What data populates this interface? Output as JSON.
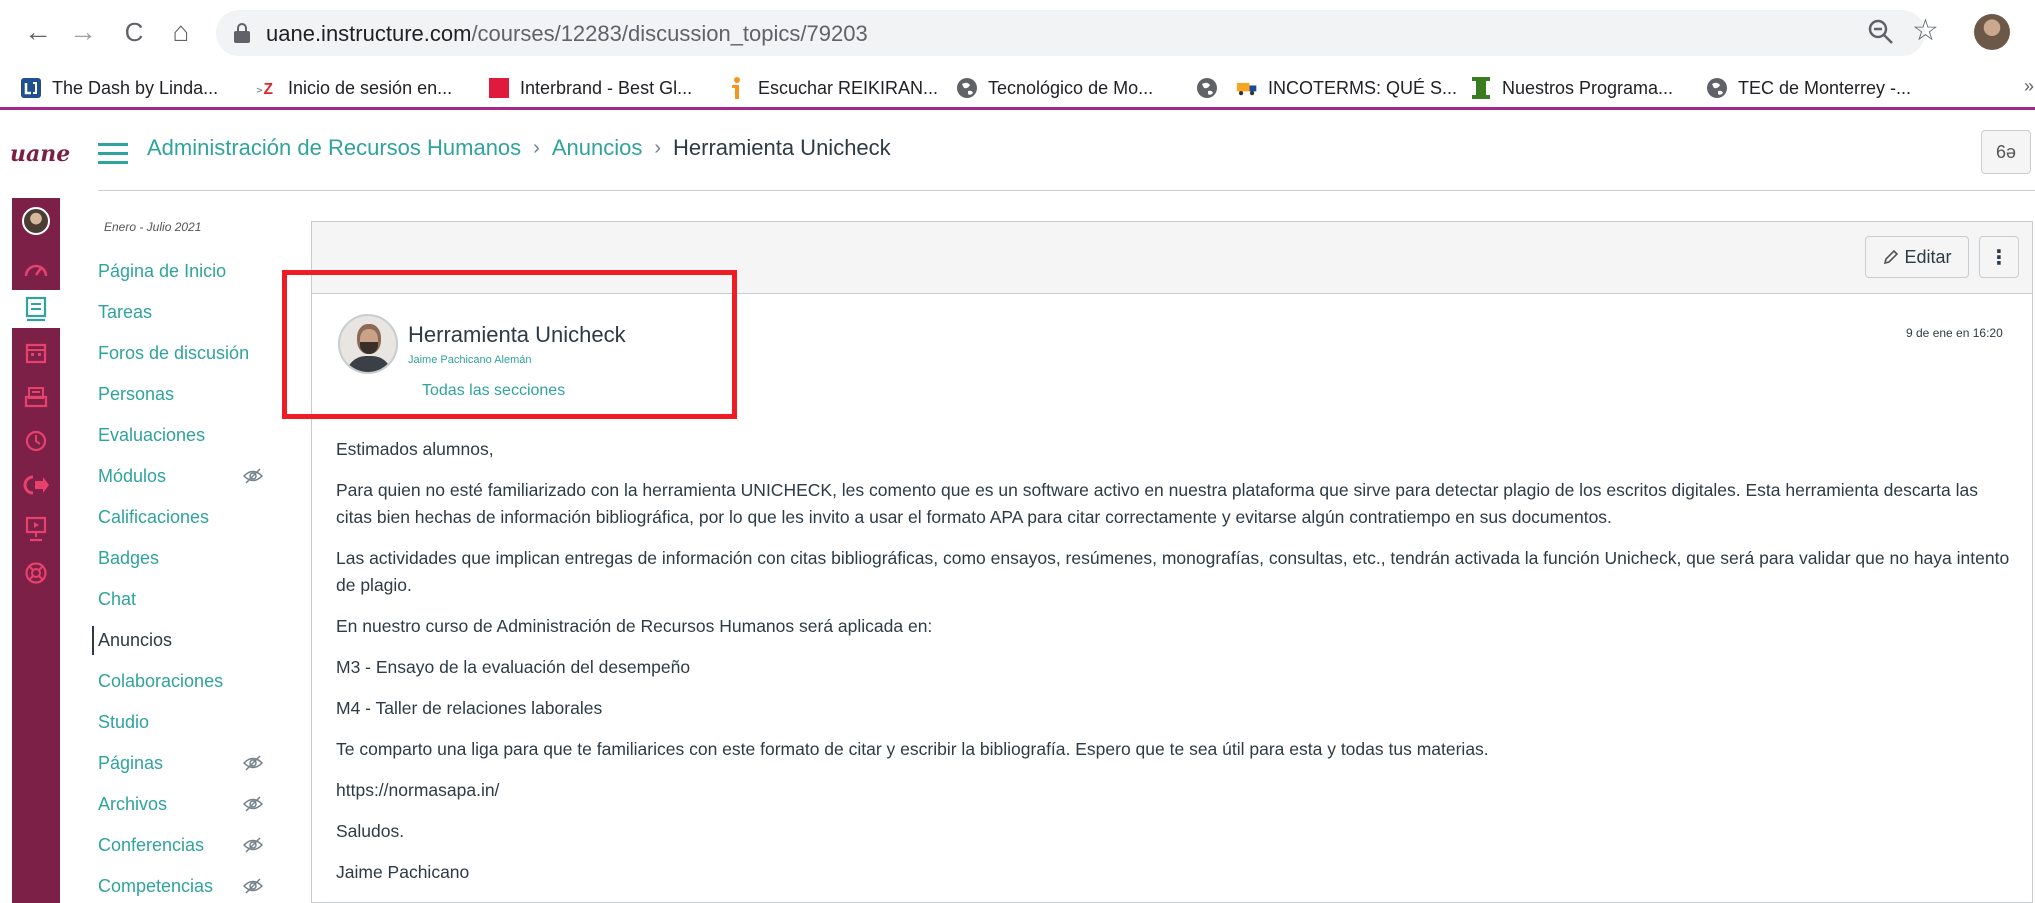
{
  "browser": {
    "url_host": "uane.instructure.com",
    "url_path": "/courses/12283/discussion_topics/79203",
    "bookmarks": [
      {
        "label": "The Dash by Linda...",
        "icon": "linda-icon",
        "color": "#1d4f91"
      },
      {
        "label": "Inicio de sesión en...",
        "icon": "zoho-icon",
        "color": "#e42527"
      },
      {
        "label": "Interbrand - Best Gl...",
        "icon": "interbrand-icon",
        "color": "#e01a3c"
      },
      {
        "label": "Escuchar REIKIRAN...",
        "icon": "ivoox-icon",
        "color": "#f7941d"
      },
      {
        "label": "Tecnológico de Mo...",
        "icon": "globe-icon",
        "color": "#5f6368"
      },
      {
        "label": "",
        "icon": "globe-icon",
        "color": "#5f6368"
      },
      {
        "label": "INCOTERMS: QUÉ S...",
        "icon": "truck-icon",
        "color": "#f5a623"
      },
      {
        "label": "Nuestros Programa...",
        "icon": "column-icon",
        "color": "#3a7d20"
      },
      {
        "label": "TEC de Monterrey -...",
        "icon": "globe-icon",
        "color": "#5f6368"
      }
    ]
  },
  "header": {
    "logo": "uane",
    "breadcrumbs": [
      "Administración de Recursos Humanos",
      "Anuncios",
      "Herramienta Unicheck"
    ],
    "immersive_label": "6ə"
  },
  "course_nav": {
    "term": "Enero - Julio 2021",
    "items": [
      {
        "label": "Página de Inicio",
        "hidden": false
      },
      {
        "label": "Tareas",
        "hidden": false
      },
      {
        "label": "Foros de discusión",
        "hidden": false
      },
      {
        "label": "Personas",
        "hidden": false
      },
      {
        "label": "Evaluaciones",
        "hidden": false
      },
      {
        "label": "Módulos",
        "hidden": true
      },
      {
        "label": "Calificaciones",
        "hidden": false
      },
      {
        "label": "Badges",
        "hidden": false
      },
      {
        "label": "Chat",
        "hidden": false
      },
      {
        "label": "Anuncios",
        "hidden": false,
        "current": true
      },
      {
        "label": "Colaboraciones",
        "hidden": false
      },
      {
        "label": "Studio",
        "hidden": false
      },
      {
        "label": "Páginas",
        "hidden": true
      },
      {
        "label": "Archivos",
        "hidden": true
      },
      {
        "label": "Conferencias",
        "hidden": true
      },
      {
        "label": "Competencias",
        "hidden": true
      }
    ]
  },
  "toolbar": {
    "edit_label": "Editar",
    "more_label": "⋮"
  },
  "post": {
    "title": "Herramienta Unicheck",
    "author": "Jaime Pachicano Alemán",
    "sections": "Todas las secciones",
    "date": "9 de ene en 16:20",
    "paragraphs": [
      "Estimados alumnos,",
      "Para quien no esté familiarizado con la herramienta UNICHECK, les comento que es un software activo en nuestra plataforma que sirve para detectar plagio de los escritos digitales. Esta herramienta descarta las citas bien hechas de información bibliográfica, por lo que les invito a usar el formato APA para citar correctamente y evitarse algún contratiempo en sus documentos.",
      "Las actividades que implican entregas de información con citas bibliográficas, como ensayos, resúmenes, monografías, consultas, etc., tendrán activada la función Unicheck, que será para validar que no haya intento de plagio.",
      "En nuestro curso de Administración de Recursos Humanos será aplicada en:",
      "M3 - Ensayo de la evaluación del desempeño",
      "M4 - Taller de relaciones laborales",
      "Te comparto una liga para que te familiarices con este formato de citar y escribir la bibliografía. Espero que te sea útil para esta y todas tus materias.",
      "https://normasapa.in/",
      "Saludos.",
      "Jaime Pachicano"
    ]
  },
  "colors": {
    "link": "#2fa39e",
    "global_nav_bg": "#7d2048",
    "global_nav_icon": "#e8416b",
    "highlight": "#ee1c25",
    "bookmark_underline": "#a5268c"
  }
}
